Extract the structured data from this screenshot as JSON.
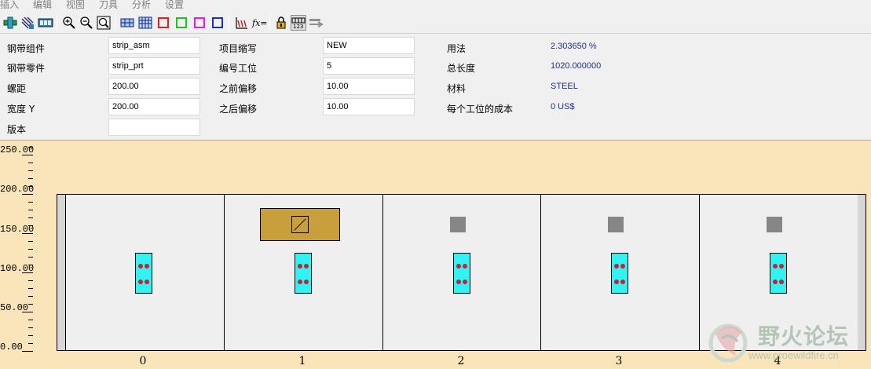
{
  "menu": {
    "items": [
      {
        "name": "menu-insert",
        "label": "插入"
      },
      {
        "name": "menu-edit",
        "label": "编辑"
      },
      {
        "name": "menu-view",
        "label": "视图"
      },
      {
        "name": "menu-tools",
        "label": "刀具"
      },
      {
        "name": "menu-analysis",
        "label": "分析"
      },
      {
        "name": "menu-settings",
        "label": "设置"
      }
    ]
  },
  "toolbar": {
    "buttons": [
      {
        "name": "strip-add-button",
        "icon": "strip-add-icon"
      },
      {
        "name": "hatch-tool-button",
        "icon": "hatch-icon"
      },
      {
        "name": "film-strip-button",
        "icon": "film-strip-icon"
      },
      {
        "name": "zoom-in-button",
        "icon": "zoom-in-icon"
      },
      {
        "name": "zoom-out-button",
        "icon": "zoom-out-icon"
      },
      {
        "name": "zoom-fit-button",
        "icon": "zoom-fit-icon"
      },
      {
        "name": "view-strip-button",
        "icon": "view-strip-icon"
      },
      {
        "name": "view-grid-button",
        "icon": "view-grid-icon"
      },
      {
        "name": "color-red-button",
        "icon": "red-square-icon",
        "color": "#e02020"
      },
      {
        "name": "color-green-button",
        "icon": "green-square-icon",
        "color": "#20c020"
      },
      {
        "name": "color-magenta-button",
        "icon": "magenta-square-icon",
        "color": "#e020e0"
      },
      {
        "name": "color-blue-button",
        "icon": "blue-square-icon",
        "color": "#2030b0"
      },
      {
        "name": "measure-button",
        "icon": "measure-icon"
      },
      {
        "name": "function-button",
        "icon": "fx-icon",
        "label": "fx="
      },
      {
        "name": "lock-button",
        "icon": "lock-icon"
      },
      {
        "name": "numbering-button",
        "icon": "numbering-icon",
        "label": "123"
      },
      {
        "name": "next-arrow-button",
        "icon": "arrow-right-icon"
      }
    ]
  },
  "params": {
    "labels": {
      "strip_asm": "钢带组件",
      "strip_prt": "钢带零件",
      "pitch": "螺距",
      "width_y": "宽度 Y",
      "version": "版本",
      "project_abbr": "项目缩写",
      "station_count": "编号工位",
      "offset_before": "之前偏移",
      "offset_after": "之后偏移",
      "usage": "用法",
      "total_length": "总长度",
      "material": "材料",
      "cost_per_station": "每个工位的成本"
    },
    "values": {
      "strip_asm": "strip_asm",
      "strip_prt": "strip_prt",
      "pitch": "200.00",
      "width_y": "200.00",
      "version": "",
      "project_abbr": "NEW",
      "station_count": "5",
      "offset_before": "10.00",
      "offset_after": "10.00",
      "usage": "2.303650 %",
      "total_length": "1020.000000",
      "material": "STEEL",
      "cost_per_station": "0 US$"
    }
  },
  "ruler": {
    "labels": [
      "250.00",
      "200.00",
      "150.00",
      "100.00",
      "50.00",
      "0.00"
    ]
  },
  "strip": {
    "colors": {
      "punch": "#33f2f2",
      "hole": "#c8203c",
      "feature": "#c99f3c",
      "square": "#868686",
      "background": "#f9e5b9"
    },
    "stations": [
      {
        "number": "0",
        "has_feature": false,
        "has_square": false
      },
      {
        "number": "1",
        "has_feature": true,
        "has_square": false
      },
      {
        "number": "2",
        "has_feature": false,
        "has_square": true
      },
      {
        "number": "3",
        "has_feature": false,
        "has_square": true
      },
      {
        "number": "4",
        "has_feature": false,
        "has_square": true
      }
    ]
  },
  "watermark": {
    "title": "野火论坛",
    "url": "www.proewildfire.cn"
  }
}
